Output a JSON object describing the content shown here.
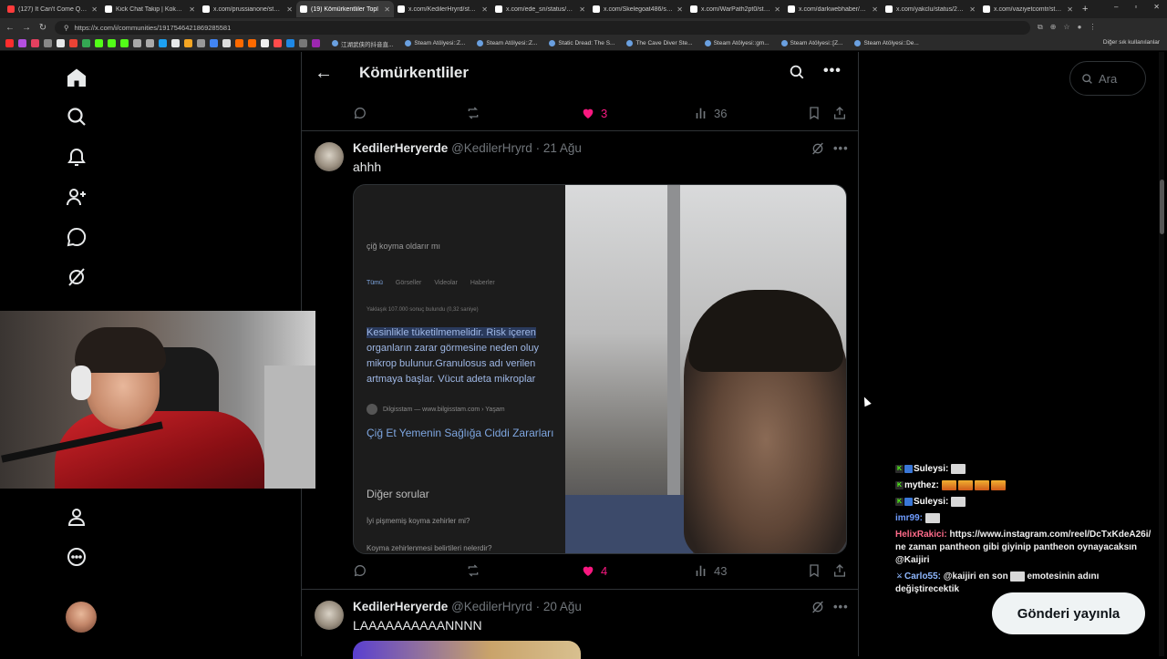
{
  "browser": {
    "tabs": [
      {
        "title": "(127) It Can't Come Quickly E",
        "color": "#ff3b3b",
        "active": false
      },
      {
        "title": "Kick Chat Takip | KokoWich",
        "color": "#ffffff",
        "active": false
      },
      {
        "title": "x.com/prussianone/status/20",
        "color": "#ffffff",
        "active": false
      },
      {
        "title": "(19) Kömürkentliler Topl",
        "color": "#ffffff",
        "active": true
      },
      {
        "title": "x.com/KedilerHryrd/status/20",
        "color": "#ffffff",
        "active": false
      },
      {
        "title": "x.com/ede_sn/status/209141",
        "color": "#ffffff",
        "active": false
      },
      {
        "title": "x.com/Skelegoat486/status/2",
        "color": "#ffffff",
        "active": false
      },
      {
        "title": "x.com/WarPath2pt0/status/2",
        "color": "#ffffff",
        "active": false
      },
      {
        "title": "x.com/darkwebhaber/status/",
        "color": "#ffffff",
        "active": false
      },
      {
        "title": "x.com/yakclu/status/20893",
        "color": "#ffffff",
        "active": false
      },
      {
        "title": "x.com/vaziyetcomtr/status/1",
        "color": "#ffffff",
        "active": false
      }
    ],
    "url": "https://x.com/i/communities/1917546421869285581",
    "bookmarks": [
      {
        "label": "江湖武侠的抖音直..."
      },
      {
        "label": "Steam Atölyesi::Z..."
      },
      {
        "label": "Steam Atölyesi::Z..."
      },
      {
        "label": "Static Dread: The S..."
      },
      {
        "label": "The Cave Diver Ste..."
      },
      {
        "label": "Steam Atölyesi::gm..."
      },
      {
        "label": "Steam Atölyesi::[Z..."
      },
      {
        "label": "Steam Atölyesi::De..."
      }
    ],
    "other_bookmarks": "Diğer sık kullanılanlar"
  },
  "header": {
    "title": "Kömürkentliler"
  },
  "tweet_prev_actions": {
    "likes": "3",
    "views": "36"
  },
  "tweet1": {
    "name": "KedilerHeryerde",
    "handle": "@KedilerHryrd",
    "date": "· 21 Ağu",
    "text": "ahhh",
    "likes": "4",
    "views": "43",
    "media": {
      "search_query": "çiğ koyma oldarır mı",
      "tabs": [
        "Tümü",
        "Görseller",
        "Videolar",
        "Haberler"
      ],
      "stats": "Yaklaşık 107.000 sonuç bulundu (0,32 saniye)",
      "highlight_lines": [
        "Kesinlikle tüketilmemelidir. Risk içeren",
        "organların zarar görmesine neden oluy",
        "mikrop bulunur.Granulosus adı verilen",
        "artmaya başlar. Vücut adeta mikroplar"
      ],
      "source": "Dilgisstam — www.bilgisstam.com › Yaşam",
      "link": "Çiğ Et Yemenin Sağlığa Ciddi Zararları",
      "other_questions": "Diğer sorular",
      "q1": "İyi pişmemiş koyma zehirler mi?",
      "q2": "Koyma zehirlenmesi belirtileri nelerdir?"
    }
  },
  "tweet2": {
    "name": "KedilerHeryerde",
    "handle": "@KedilerHryrd",
    "date": "· 20 Ağu",
    "text": "LAAAAAAAAAANNNN"
  },
  "sidebar_search": {
    "placeholder": "Ara"
  },
  "chat": [
    {
      "user": "Suleysi:",
      "color": "#ffffff",
      "badges": [
        "k",
        "blue"
      ],
      "emotes": [
        "gray"
      ],
      "text": ""
    },
    {
      "user": "mythez:",
      "color": "#ffffff",
      "badges": [
        "k"
      ],
      "emotes": [
        "fire",
        "fire",
        "fire",
        "fire"
      ],
      "text": ""
    },
    {
      "user": "Suleysi:",
      "color": "#ffffff",
      "badges": [
        "k",
        "blue"
      ],
      "emotes": [
        "gray"
      ],
      "text": ""
    },
    {
      "user": "imr99:",
      "color": "#6f9cff",
      "badges": [],
      "emotes": [
        "gray"
      ],
      "text": ""
    },
    {
      "user": "HelixRakici:",
      "color": "#ff6b8a",
      "badges": [],
      "emotes": [],
      "text": "https://www.instagram.com/reel/DcTxKdeA26i/ ne zaman pantheon gibi giyinip pantheon oynayacaksın @Kaijiri"
    },
    {
      "user": "Carlo55:",
      "color": "#8fb8ff",
      "badges": [
        "sword"
      ],
      "emotes": [],
      "text": "@kaijiri en son",
      "text2": "emotesinin adını değiştirecektik"
    }
  ],
  "post_button": "Gönderi yayınla",
  "colors": {
    "like": "#f91880",
    "muted": "#71767b",
    "text": "#e7e9ea",
    "border": "#2f3336"
  }
}
